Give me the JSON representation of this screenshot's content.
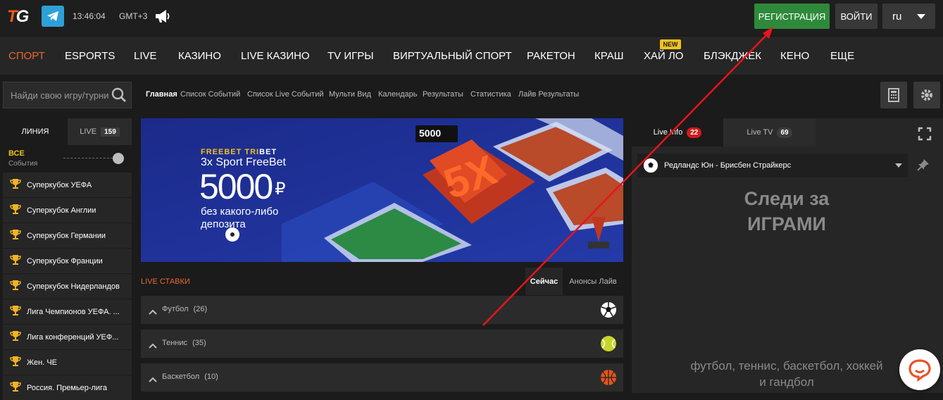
{
  "header": {
    "logo_t": "T",
    "logo_g": "G",
    "clock": "13:46:04",
    "timezone": "GMT+3",
    "register_label": "РЕГИСТРАЦИЯ",
    "login_label": "ВОЙТИ",
    "language": "ru",
    "accent_color": "#e8672c",
    "register_color": "#2e8a3a"
  },
  "nav": {
    "items": [
      "СПОРТ",
      "ESPORTS",
      "LIVE",
      "КАЗИНО",
      "LIVE КАЗИНО",
      "TV ИГРЫ",
      "ВИРТУАЛЬНЫЙ СПОРТ",
      "РАКЕТОН",
      "КРАШ",
      "ХАЙ ЛО",
      "БЛЭКДЖЕК",
      "КЕНО",
      "ЕЩЕ"
    ],
    "new_badge": "NEW"
  },
  "search": {
    "placeholder": "Найди свою игру/турнир"
  },
  "subnav": [
    "Главная",
    "Список Событий",
    "Список Live Событий",
    "Мульти Вид",
    "Календарь",
    "Результаты",
    "Статистика",
    "Лайв Результаты"
  ],
  "left": {
    "tab_line": "ЛИНИЯ",
    "tab_live": "LIVE",
    "live_count": "159",
    "all_title": "ВСЕ",
    "all_sub": "События",
    "leagues": [
      "Суперкубок УЕФА",
      "Суперкубок Англии",
      "Суперкубок Германии",
      "Суперкубок Франции",
      "Суперкубок Нидерландов",
      "Лига Чемпионов УЕФА. ...",
      "Лига конференций УЕФ...",
      "Жен. ЧЕ",
      "Россия. Премьер-лига"
    ]
  },
  "banner": {
    "brand": "FREEBET TRI",
    "brand_bet": "BET",
    "promo": "3x Sport FreeBet",
    "amount": "5000",
    "currency": "₽",
    "line1": "без какого-либо",
    "line2": "депозита",
    "badge": "5000"
  },
  "live": {
    "title": "LIVE СТАВКИ",
    "tab_now": "Сейчас",
    "tab_announce": "Анонсы Лайв",
    "sports": [
      {
        "name": "Футбол",
        "count": "(26)"
      },
      {
        "name": "Теннис",
        "count": "(35)"
      },
      {
        "name": "Баскетбол",
        "count": "(10)"
      }
    ]
  },
  "right": {
    "tab_info": "Live Info",
    "info_count": "22",
    "tab_tv": "Live TV",
    "tv_count": "69",
    "match": "Редландс Юн - Брисбен Страйкерс",
    "big_line1": "Следи за",
    "big_line2": "ИГРАМИ",
    "sports_line1": "футбол, теннис, баскетбол, хоккей",
    "sports_line2": "и гандбол"
  }
}
